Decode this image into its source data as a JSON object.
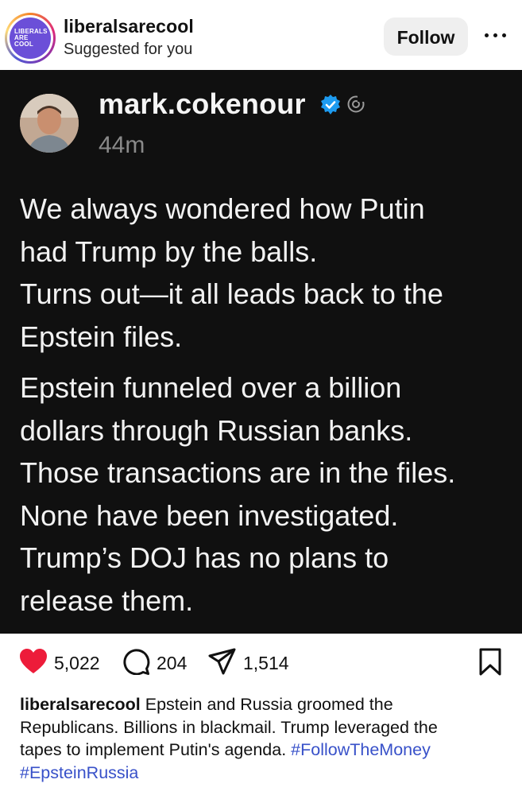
{
  "header": {
    "avatar_logo_lines": [
      "LIBERALS",
      "ARE",
      "COOL"
    ],
    "account_name": "liberalsarecool",
    "subtitle": "Suggested for you",
    "follow_label": "Follow",
    "more_icon": "ellipsis-icon"
  },
  "post": {
    "author": "mark.cokenour",
    "verified_icon": "verified-badge-icon",
    "platform_icon": "threads-icon",
    "time": "44m",
    "paragraph1": [
      "We always wondered how Putin",
      "had Trump by the balls.",
      "Turns out—it all leads back to the",
      "Epstein files."
    ],
    "paragraph2": [
      "Epstein funneled over a billion",
      "dollars through Russian banks.",
      "Those transactions are in the files.",
      "None have been investigated.",
      "Trump’s DOJ has no plans to",
      "release them."
    ]
  },
  "actions": {
    "likes": "5,022",
    "comments": "204",
    "shares": "1,514",
    "like_color": "#ed1c3a"
  },
  "caption": {
    "username": "liberalsarecool",
    "line1": " Epstein and Russia groomed the",
    "line2": "Republicans. Billions in blackmail. Trump leveraged the",
    "line3": "tapes to implement Putin's agenda. ",
    "hashtag1": "#FollowTheMoney",
    "hashtag2": "#EpsteinRussia",
    "hashtag_color": "#3851c9"
  }
}
